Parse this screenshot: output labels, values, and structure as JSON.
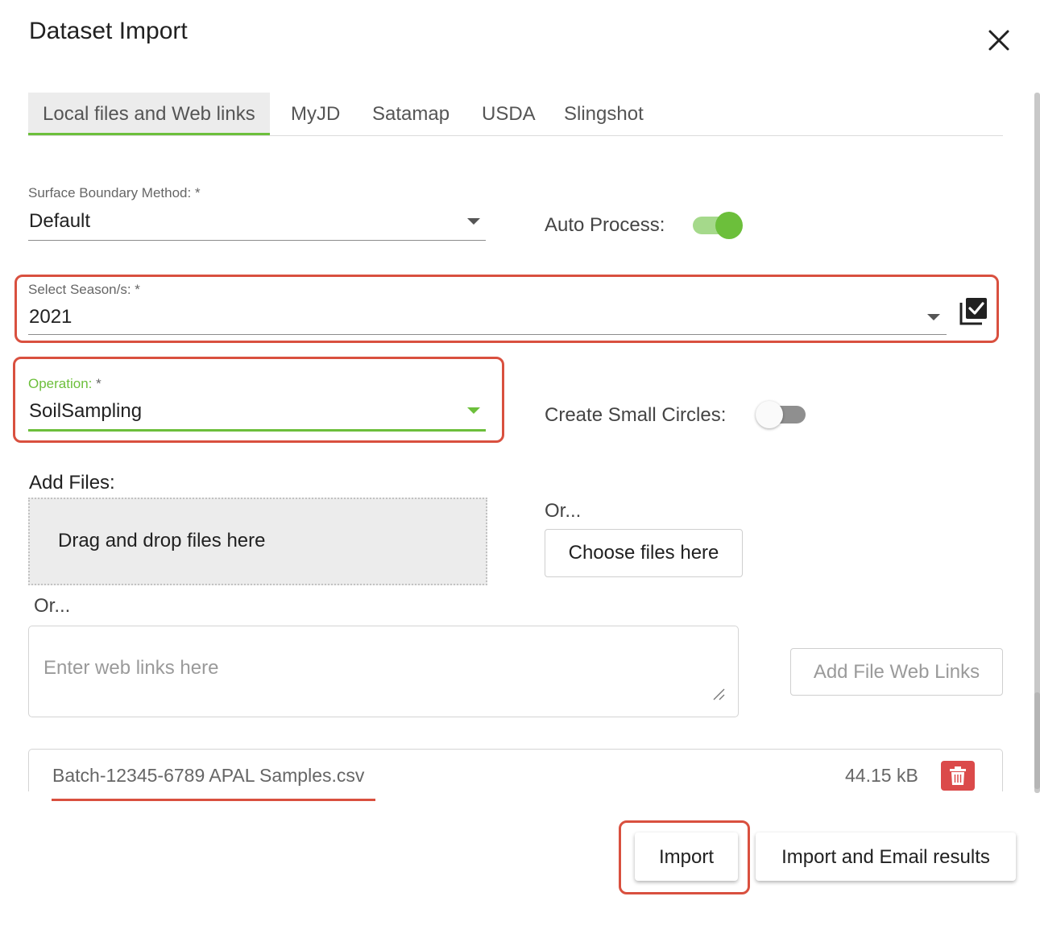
{
  "dialog": {
    "title": "Dataset Import"
  },
  "tabs": [
    {
      "label": "Local files and Web links",
      "active": true
    },
    {
      "label": "MyJD"
    },
    {
      "label": "Satamap"
    },
    {
      "label": "USDA"
    },
    {
      "label": "Slingshot"
    }
  ],
  "surface_boundary": {
    "label": "Surface Boundary Method: *",
    "value": "Default"
  },
  "auto_process": {
    "label": "Auto Process:",
    "on": true
  },
  "season": {
    "label": "Select Season/s: *",
    "value": "2021"
  },
  "operation": {
    "label": "Operation: *",
    "value": "SoilSampling"
  },
  "small_circles": {
    "label": "Create Small Circles:",
    "on": false
  },
  "add_files": {
    "label": "Add Files:",
    "dropzone_text": "Drag and drop files here",
    "or_label_1": "Or...",
    "choose_button": "Choose files here",
    "or_label_2": "Or...",
    "web_links_placeholder": "Enter web links here",
    "add_links_button": "Add File Web Links"
  },
  "file": {
    "name": "Batch-12345-6789 APAL Samples.csv",
    "size": "44.15 kB"
  },
  "actions": {
    "import_label": "Import",
    "import_email_label": "Import and Email results"
  },
  "colors": {
    "accent_green": "#6cbf3b",
    "highlight_red": "#d9503f",
    "delete_red": "#db4a4a"
  },
  "icons": [
    "close-icon",
    "caret-down-icon",
    "select-all-checkbox-icon",
    "resize-handle-icon",
    "trash-icon"
  ]
}
